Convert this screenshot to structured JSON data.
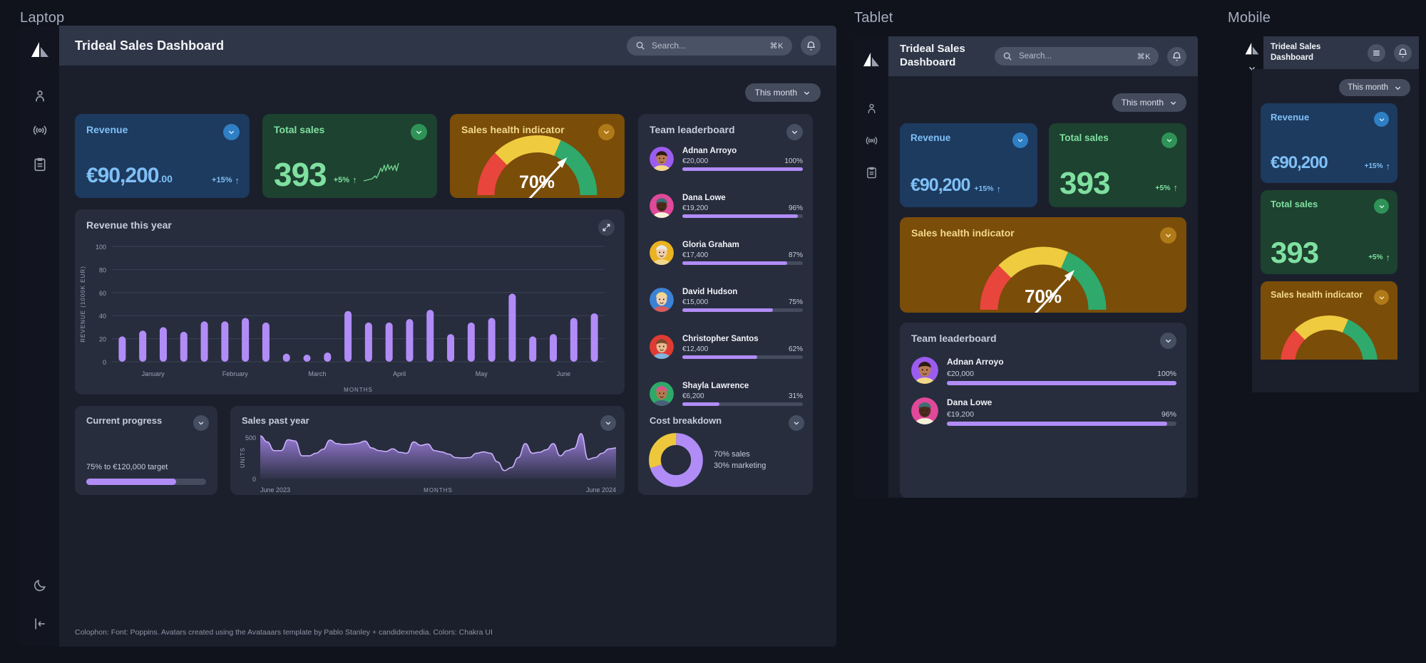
{
  "devices": {
    "laptop": "Laptop",
    "tablet": "Tablet",
    "mobile": "Mobile"
  },
  "app": {
    "title": "Trideal Sales Dashboard",
    "search_placeholder": "Search...",
    "search_shortcut": "⌘K",
    "period": "This month"
  },
  "rail": {
    "logo": "trideal-logo",
    "items": [
      {
        "icon": "person-icon",
        "name": "sidebar-item-profile"
      },
      {
        "icon": "broadcast-icon",
        "name": "sidebar-item-broadcast"
      },
      {
        "icon": "clipboard-icon",
        "name": "sidebar-item-reports"
      }
    ],
    "bottom": [
      {
        "icon": "moon-icon",
        "name": "sidebar-item-dark-mode"
      },
      {
        "icon": "logout-icon",
        "name": "sidebar-item-logout"
      }
    ]
  },
  "kpis": {
    "revenue": {
      "title": "Revenue",
      "value": "€90,200",
      "cents": ".00",
      "delta": "+15%",
      "arrow": "↑"
    },
    "total_sales": {
      "title": "Total sales",
      "value": "393",
      "delta": "+5%",
      "arrow": "↑"
    },
    "health": {
      "title": "Sales health indicator",
      "value": "70%"
    }
  },
  "leaderboard": {
    "title": "Team leaderboard",
    "rows": [
      {
        "name": "Adnan Arroyo",
        "amount": "€20,000",
        "percent": "100%",
        "pct": 100,
        "ring": "#9b5cf0",
        "skin": "#b97a50",
        "hair": "#2b1b12",
        "shirt": "#f3d88a"
      },
      {
        "name": "Dana Lowe",
        "amount": "€19,200",
        "percent": "96%",
        "pct": 96,
        "ring": "#e0489a",
        "skin": "#4b2c1d",
        "hair": "#3a6f74",
        "shirt": "#f6f0d8"
      },
      {
        "name": "Gloria Graham",
        "amount": "€17,400",
        "percent": "87%",
        "pct": 87,
        "ring": "#eab322",
        "skin": "#f0cfae",
        "hair": "#e8e8e8",
        "shirt": "#f2d88c"
      },
      {
        "name": "David Hudson",
        "amount": "€15,000",
        "percent": "75%",
        "pct": 75,
        "ring": "#3b82d6",
        "skin": "#f3d0ab",
        "hair": "#f0d88a",
        "shirt": "#d95b5b"
      },
      {
        "name": "Christopher Santos",
        "amount": "€12,400",
        "percent": "62%",
        "pct": 62,
        "ring": "#e03b33",
        "skin": "#e8bb93",
        "hair": "#7b4a2a",
        "shirt": "#7fb4dd"
      },
      {
        "name": "Shayla Lawrence",
        "amount": "€6,200",
        "percent": "31%",
        "pct": 31,
        "ring": "#2fa968",
        "skin": "#b6794f",
        "hair": "#e0518a",
        "shirt": "#4a5f78"
      }
    ]
  },
  "current_progress": {
    "title": "Current progress",
    "caption": "75% to €120,000 target",
    "pct": 75
  },
  "cost_breakdown": {
    "title": "Cost breakdown",
    "legend": [
      "70% sales",
      "30% marketing"
    ]
  },
  "colophon": "Colophon: Font: Poppins. Avatars created using the Avataaars template by Pablo Stanley + candidexmedia. Colors: Chakra UI",
  "chart_data": [
    {
      "type": "bar",
      "title": "Revenue this year",
      "xlabel": "MONTHS",
      "ylabel": "REVENUE (1000K EUR)",
      "ylim": [
        0,
        100
      ],
      "yticks": [
        0,
        20,
        40,
        60,
        80,
        100
      ],
      "categories": [
        "January",
        "February",
        "March",
        "April",
        "May",
        "June"
      ],
      "values": [
        22,
        27,
        30,
        26,
        35,
        35,
        38,
        34,
        7,
        3,
        8,
        44,
        34,
        34,
        37,
        45,
        24,
        34,
        38,
        59,
        22,
        24,
        38,
        42
      ],
      "grid": true,
      "series_color": "#b18cf7"
    },
    {
      "type": "area",
      "title": "Sales past year",
      "ylabel": "UNITS",
      "xlabel": "MONTHS",
      "ylim": [
        0,
        500
      ],
      "yticks": [
        0,
        500
      ],
      "x_start_label": "June 2023",
      "x_end_label": "June 2024",
      "values": [
        500,
        430,
        330,
        330,
        455,
        440,
        270,
        270,
        300,
        345,
        450,
        410,
        400,
        405,
        415,
        440,
        360,
        330,
        320,
        350,
        310,
        300,
        430,
        390,
        405,
        330,
        315,
        290,
        250,
        245,
        250,
        300,
        315,
        300,
        200,
        100,
        135,
        250,
        410,
        300,
        310,
        340,
        410,
        270,
        330,
        355,
        525,
        230,
        250,
        300,
        350,
        360
      ],
      "series_color": "#b18cf7"
    },
    {
      "type": "pie",
      "title": "Cost breakdown",
      "labels": [
        "sales",
        "marketing"
      ],
      "values": [
        70,
        30
      ],
      "colors": [
        "#b18cf7",
        "#eec83c"
      ]
    },
    {
      "type": "gauge",
      "title": "Sales health indicator",
      "value": 70,
      "ylim": [
        0,
        100
      ],
      "segments": [
        {
          "label": "low",
          "from": 0,
          "to": 28,
          "color": "#e8453c"
        },
        {
          "label": "mid",
          "from": 28,
          "to": 64,
          "color": "#efcb3f"
        },
        {
          "label": "high",
          "from": 64,
          "to": 100,
          "color": "#2fa96c"
        }
      ]
    },
    {
      "type": "line",
      "title": "Total sales sparkline",
      "values": [
        2,
        3,
        4,
        4,
        6,
        5,
        7,
        9,
        8,
        13,
        9,
        15,
        10,
        16,
        12,
        19,
        14,
        21
      ],
      "series_color": "#6fd08c"
    }
  ]
}
